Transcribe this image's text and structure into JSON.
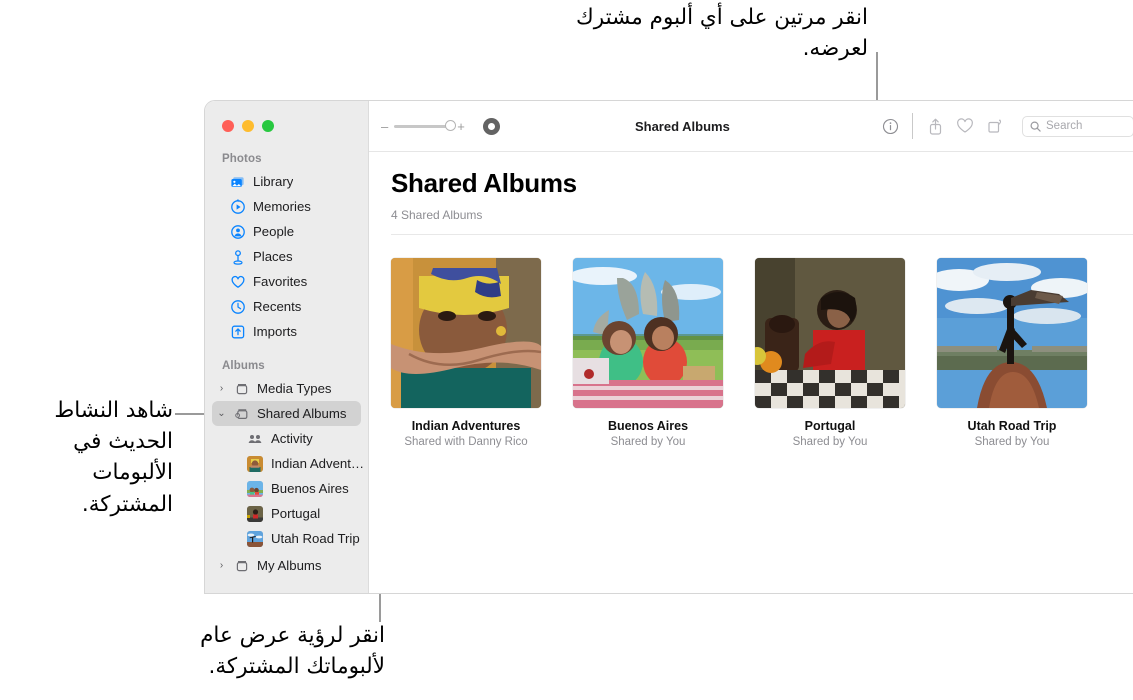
{
  "annotations": {
    "top": "انقر مرتين على أي ألبوم مشترك لعرضه.",
    "left": "شاهد النشاط الحديث في الألبومات المشتركة.",
    "bottom": "انقر لرؤية عرض عام لألبوماتك المشتركة."
  },
  "window": {
    "traffic_lights": [
      "close",
      "minimize",
      "zoom"
    ]
  },
  "sidebar": {
    "sections": [
      {
        "label": "Photos",
        "items": [
          {
            "label": "Library",
            "icon": "library-icon"
          },
          {
            "label": "Memories",
            "icon": "memories-icon"
          },
          {
            "label": "People",
            "icon": "people-icon"
          },
          {
            "label": "Places",
            "icon": "places-icon"
          },
          {
            "label": "Favorites",
            "icon": "heart-icon"
          },
          {
            "label": "Recents",
            "icon": "clock-icon"
          },
          {
            "label": "Imports",
            "icon": "import-icon"
          }
        ]
      },
      {
        "label": "Albums",
        "items": [
          {
            "label": "Media Types",
            "icon": "folder-icon",
            "twisty": "›",
            "selected": false
          },
          {
            "label": "Shared Albums",
            "icon": "shared-folder-icon",
            "twisty": "⌄",
            "selected": true
          },
          {
            "label": "Activity",
            "icon": "activity-icon",
            "child": true
          },
          {
            "label": "Indian Advent…",
            "icon": "thumb-indian",
            "child": true
          },
          {
            "label": "Buenos Aires",
            "icon": "thumb-buenos",
            "child": true
          },
          {
            "label": "Portugal",
            "icon": "thumb-portugal",
            "child": true
          },
          {
            "label": "Utah Road Trip",
            "icon": "thumb-utah",
            "child": true
          },
          {
            "label": "My Albums",
            "icon": "folder-icon",
            "twisty": "›",
            "selected": false
          }
        ]
      }
    ]
  },
  "toolbar": {
    "zoom_minus": "–",
    "zoom_plus": "+",
    "title": "Shared Albums",
    "icons": [
      "info-icon",
      "share-icon",
      "heart-icon",
      "rotate-icon"
    ],
    "search_placeholder": "Search"
  },
  "main": {
    "title": "Shared Albums",
    "subtitle": "4 Shared Albums",
    "albums": [
      {
        "name": "Indian Adventures",
        "shared": "Shared with Danny Rico",
        "image": "portrait-headwrap"
      },
      {
        "name": "Buenos Aires",
        "shared": "Shared by You",
        "image": "kids-picnic"
      },
      {
        "name": "Portugal",
        "shared": "Shared by You",
        "image": "woman-red-table"
      },
      {
        "name": "Utah Road Trip",
        "shared": "Shared by You",
        "image": "desert-silhouette"
      }
    ]
  },
  "colors": {
    "accent": "#0a84ff",
    "sidebar_bg": "#ececec",
    "selected_row": "#d2d2d2",
    "muted_text": "#8d8d92",
    "leader_line": "#9a9a9a"
  }
}
